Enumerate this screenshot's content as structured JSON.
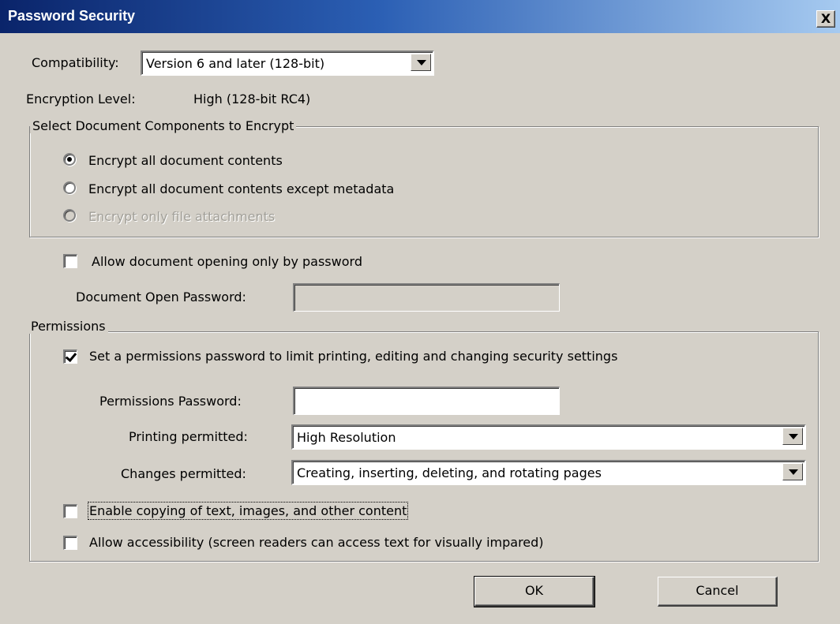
{
  "window": {
    "title": "Password Security",
    "close_glyph": "X"
  },
  "compatibility": {
    "label": "Compatibility:",
    "value": "Version 6 and later (128-bit)"
  },
  "encryption": {
    "label": "Encryption  Level:",
    "value": "High (128-bit RC4)"
  },
  "components_group": {
    "legend": "Select Document Components to Encrypt",
    "options": [
      {
        "label": "Encrypt all document contents",
        "selected": true,
        "enabled": true
      },
      {
        "label": "Encrypt all document contents except metadata",
        "selected": false,
        "enabled": true
      },
      {
        "label": "Encrypt only file attachments",
        "selected": false,
        "enabled": false
      }
    ]
  },
  "open_password": {
    "checkbox_label": "Allow document opening only by password",
    "checked": false,
    "field_label": "Document Open Password:",
    "value": ""
  },
  "permissions_group": {
    "legend": "Permissions",
    "set_password_label": "Set a permissions password to limit printing, editing and changing security settings",
    "set_password_checked": true,
    "password_label": "Permissions Password:",
    "password_value": "",
    "printing_label": "Printing permitted:",
    "printing_value": "High Resolution",
    "changes_label": "Changes permitted:",
    "changes_value": "Creating, inserting, deleting, and rotating pages",
    "copy_label": "Enable copying of text, images, and other content",
    "copy_checked": false,
    "accessibility_label": "Allow accessibility (screen readers can access text for visually impared)",
    "accessibility_checked": false
  },
  "buttons": {
    "ok": "OK",
    "cancel": "Cancel"
  }
}
